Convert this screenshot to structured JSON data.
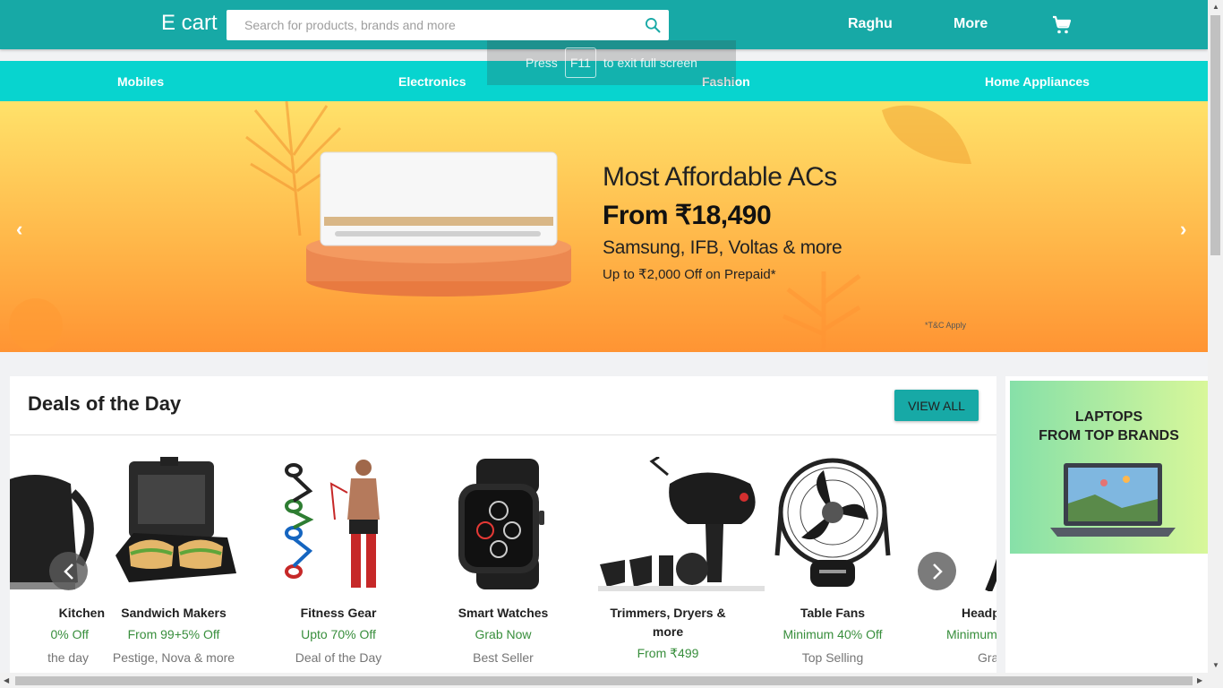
{
  "header": {
    "logo": "E cart",
    "search_placeholder": "Search for products, brands and more",
    "user": "Raghu",
    "more": "More"
  },
  "categories": [
    "Mobiles",
    "Electronics",
    "Fashion",
    "Home Appliances"
  ],
  "fullscreen_toast": {
    "before": "Press",
    "key": "F11",
    "after": "to exit full screen"
  },
  "banner": {
    "title": "Most Affordable ACs",
    "price": "From ₹18,490",
    "brands": "Samsung, IFB, Voltas & more",
    "offer": "Up to ₹2,000 Off on Prepaid*",
    "tc": "*T&C Apply"
  },
  "deals": {
    "title": "Deals of the Day",
    "view_all": "VIEW ALL",
    "items": [
      {
        "name": "Kitchen",
        "offer": "0% Off",
        "sub": "the day"
      },
      {
        "name": "Sandwich Makers",
        "offer": "From 99+5% Off",
        "sub": "Pestige, Nova & more"
      },
      {
        "name": "Fitness Gear",
        "offer": "Upto 70% Off",
        "sub": "Deal of the Day"
      },
      {
        "name": "Smart Watches",
        "offer": "Grab Now",
        "sub": "Best Seller"
      },
      {
        "name": "Trimmers, Dryers & more",
        "offer": "From ₹499",
        "sub": ""
      },
      {
        "name": "Table Fans",
        "offer": "Minimum 40% Off",
        "sub": "Top Selling"
      },
      {
        "name": "Headp",
        "offer": "Minimum",
        "sub": "Grab"
      }
    ]
  },
  "side_ad": {
    "line1": "LAPTOPS",
    "line2": "FROM TOP BRANDS"
  },
  "colors": {
    "header": "#17a9a6",
    "category_bar": "#08d4cf",
    "offer_green": "#388e3c"
  }
}
